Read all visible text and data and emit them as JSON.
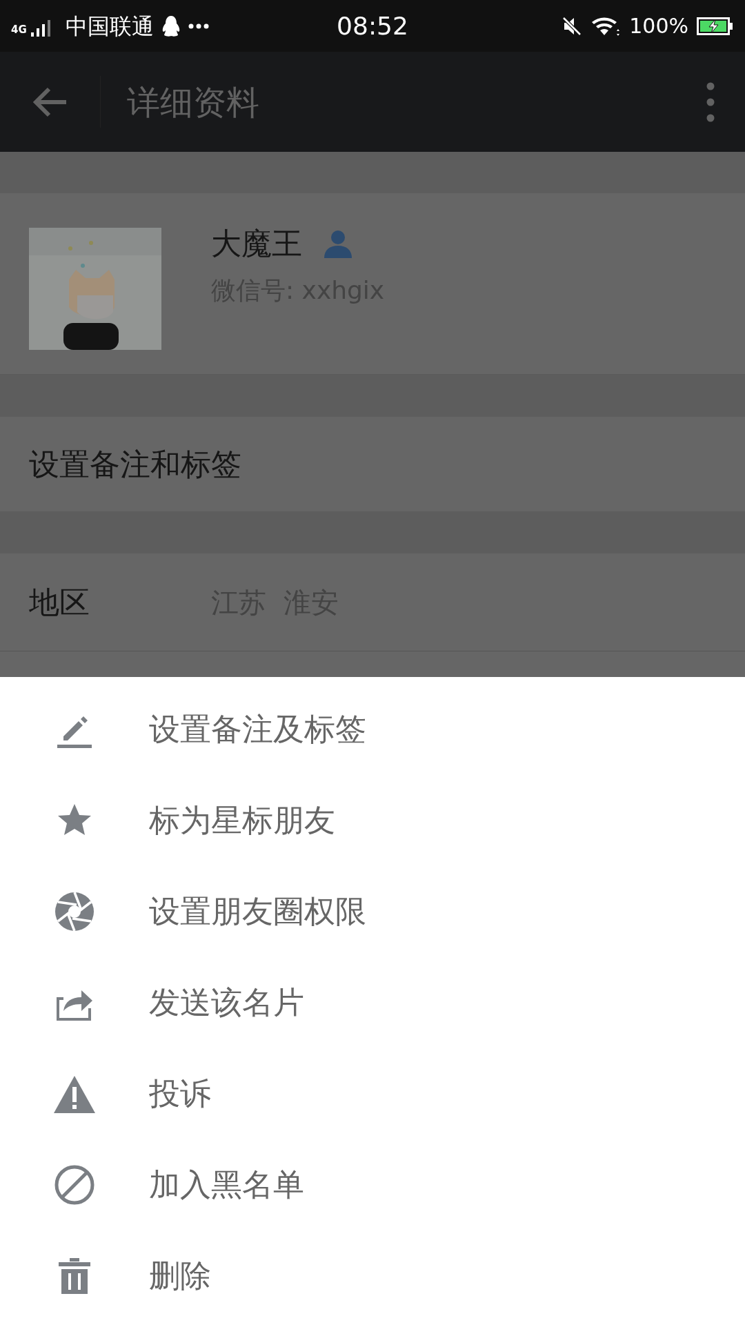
{
  "status_bar": {
    "network": "4G",
    "carrier": "中国联通",
    "time": "08:52",
    "battery": "100%",
    "charging": true
  },
  "app_bar": {
    "title": "详细资料"
  },
  "profile": {
    "name": "大魔王",
    "wechat_id": "微信号: xxhgix"
  },
  "remark_row": {
    "label": "设置备注和标签"
  },
  "region_row": {
    "label": "地区",
    "value": "江苏  淮安"
  },
  "menu": [
    {
      "kind": "edit",
      "label": "设置备注及标签"
    },
    {
      "kind": "star",
      "label": "标为星标朋友"
    },
    {
      "kind": "aperture",
      "label": "设置朋友圈权限"
    },
    {
      "kind": "share",
      "label": "发送该名片"
    },
    {
      "kind": "warning",
      "label": "投诉"
    },
    {
      "kind": "block",
      "label": "加入黑名单"
    },
    {
      "kind": "trash",
      "label": "删除"
    }
  ]
}
